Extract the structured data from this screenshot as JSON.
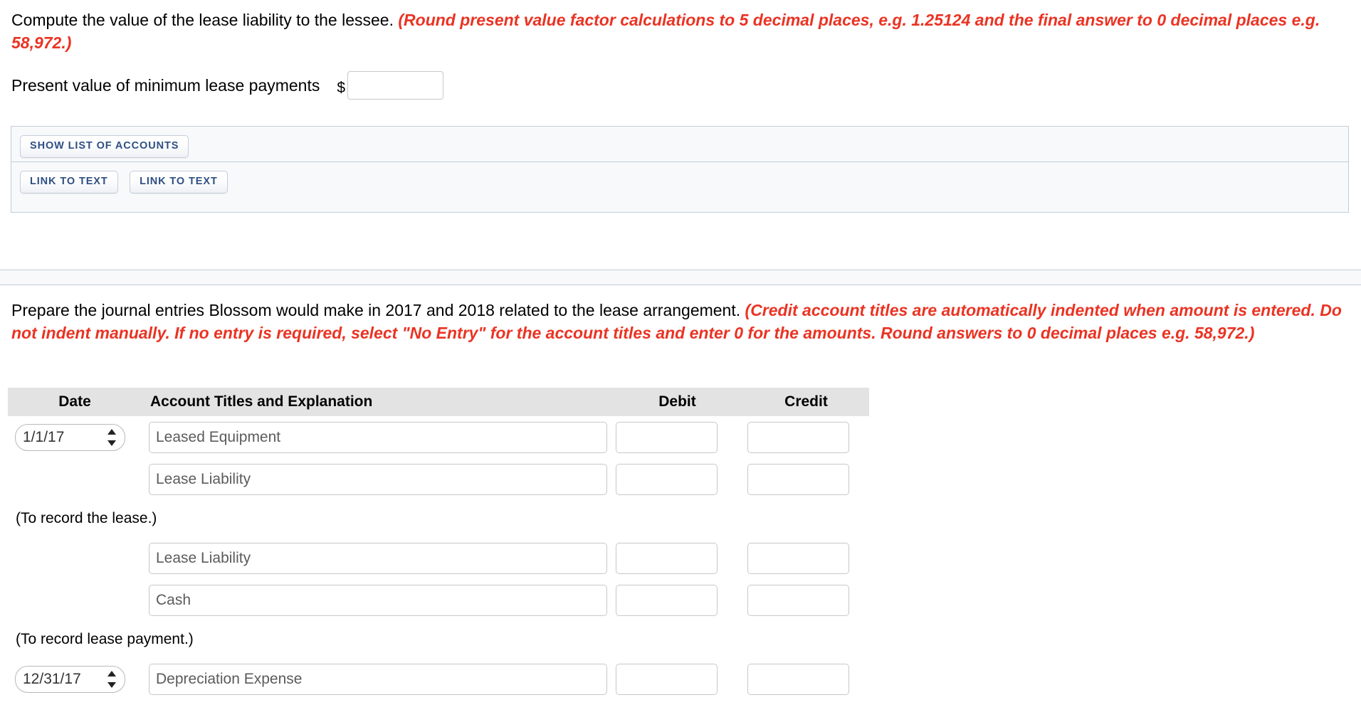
{
  "section1": {
    "prompt_plain": "Compute the value of the lease liability to the lessee. ",
    "prompt_emphasis": "(Round present value factor calculations to 5 decimal places, e.g. 1.25124 and the final answer to 0 decimal places e.g. 58,972.)",
    "pv_label": "Present value of minimum lease payments",
    "currency_symbol": "$",
    "pv_input_value": "",
    "pv_input_placeholder": ""
  },
  "action_panel": {
    "show_list_label": "SHOW LIST OF ACCOUNTS",
    "link_to_text_1_label": "LINK TO TEXT",
    "link_to_text_2_label": "LINK TO TEXT"
  },
  "section2": {
    "prompt_plain": "Prepare the journal entries Blossom would make in 2017 and 2018 related to the lease arrangement. ",
    "prompt_emphasis": "(Credit account titles are automatically indented when amount is entered. Do not indent manually. If no entry is required, select \"No Entry\" for the account titles and enter 0 for the amounts. Round answers to 0 decimal places e.g. 58,972.)"
  },
  "journal": {
    "headers": {
      "date": "Date",
      "account": "Account Titles and Explanation",
      "debit": "Debit",
      "credit": "Credit"
    },
    "rows": [
      {
        "type": "entry",
        "date": "1/1/17",
        "has_date": true,
        "account": "Leased Equipment",
        "debit": "",
        "credit": ""
      },
      {
        "type": "entry",
        "date": "",
        "has_date": false,
        "account": "Lease Liability",
        "debit": "",
        "credit": ""
      },
      {
        "type": "memo",
        "memo": "(To record the lease.)"
      },
      {
        "type": "entry",
        "date": "",
        "has_date": false,
        "account": "Lease Liability",
        "debit": "",
        "credit": ""
      },
      {
        "type": "entry",
        "date": "",
        "has_date": false,
        "account": "Cash",
        "debit": "",
        "credit": ""
      },
      {
        "type": "memo",
        "memo": "(To record lease payment.)"
      },
      {
        "type": "entry",
        "date": "12/31/17",
        "has_date": true,
        "account": "Depreciation Expense",
        "debit": "",
        "credit": ""
      }
    ]
  },
  "colors": {
    "emphasis_red": "#ea3323",
    "button_text_blue": "#2e4f82",
    "panel_bg": "#f7f9fb",
    "panel_border": "#c3ccd8",
    "table_header_bg": "#e3e3e3"
  }
}
